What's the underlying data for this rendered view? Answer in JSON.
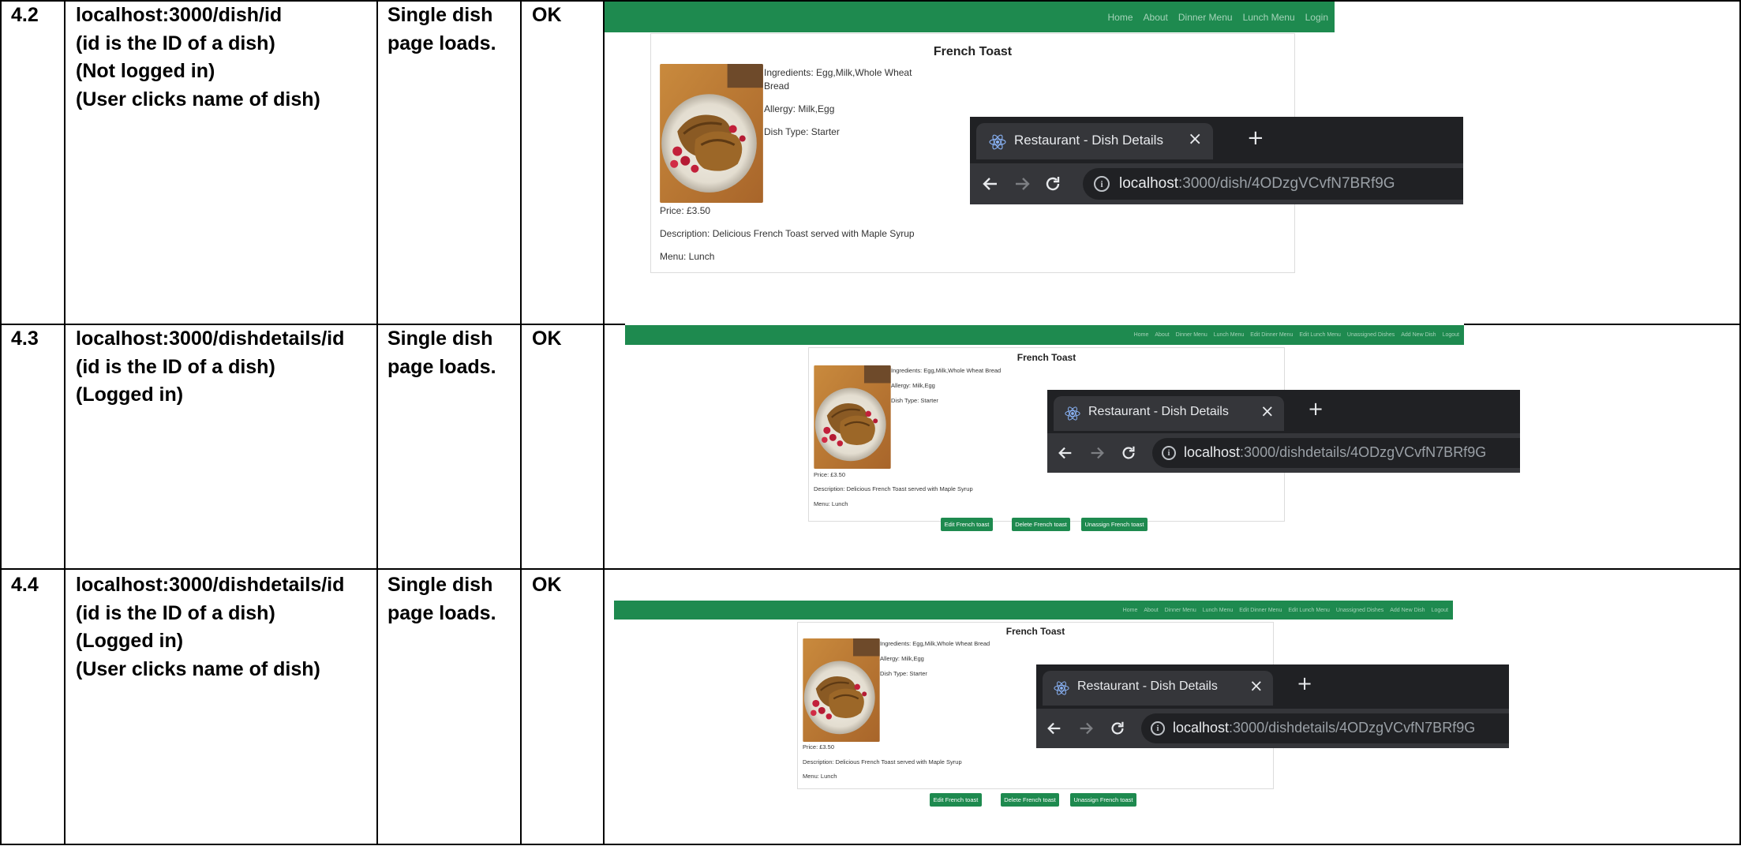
{
  "rows": [
    {
      "id": "4.2",
      "description_lines": [
        "localhost:3000/dish/id",
        "(id is the ID of a dish)",
        "(Not logged in)",
        "(User clicks name of dish)"
      ],
      "expected_lines": [
        "Single dish",
        "page loads."
      ],
      "result": "OK"
    },
    {
      "id": "4.3",
      "description_lines": [
        "localhost:3000/dishdetails/id",
        "(id is the ID of a dish)",
        "(Logged in)"
      ],
      "expected_lines": [
        "Single dish",
        "page loads."
      ],
      "result": "OK"
    },
    {
      "id": "4.4",
      "description_lines": [
        "localhost:3000/dishdetails/id",
        "(id is the ID of a dish)",
        "(Logged in)",
        "(User clicks name of dish)"
      ],
      "expected_lines": [
        "Single dish",
        "page loads."
      ],
      "result": "OK"
    }
  ],
  "screens": [
    {
      "nav": [
        "Home",
        "About",
        "Dinner Menu",
        "Lunch Menu",
        "Login"
      ],
      "dish": {
        "title": "French Toast",
        "ingredients": "Ingredients: Egg,Milk,Whole Wheat",
        "ingredients_cont": "Bread",
        "allergy": "Allergy: Milk,Egg",
        "type": "Dish Type: Starter",
        "price": "Price: £3.50",
        "description": "Description: Delicious French Toast served with Maple Syrup",
        "menu": "Menu: Lunch"
      },
      "browser": {
        "tab_title": "Restaurant - Dish Details",
        "url_host": "localhost",
        "url_path": ":3000/dish/4ODzgVCvfN7BRf9G"
      }
    },
    {
      "nav": [
        "Home",
        "About",
        "Dinner Menu",
        "Lunch Menu",
        "Edit Dinner Menu",
        "Edit Lunch Menu",
        "Unassigned Dishes",
        "Add New Dish",
        "Logout"
      ],
      "dish": {
        "title": "French Toast",
        "ingredients": "Ingredients: Egg,Milk,Whole Wheat Bread",
        "allergy": "Allergy: Milk,Egg",
        "type": "Dish Type: Starter",
        "price": "Price: £3.50",
        "description": "Description: Delicious French Toast served with Maple Syrup",
        "menu": "Menu: Lunch"
      },
      "buttons": [
        "Edit French toast",
        "Delete French toast",
        "Unassign French toast"
      ],
      "browser": {
        "tab_title": "Restaurant - Dish Details",
        "url_host": "localhost",
        "url_path": ":3000/dishdetails/4ODzgVCvfN7BRf9G"
      }
    },
    {
      "nav": [
        "Home",
        "About",
        "Dinner Menu",
        "Lunch Menu",
        "Edit Dinner Menu",
        "Edit Lunch Menu",
        "Unassigned Dishes",
        "Add New Dish",
        "Logout"
      ],
      "dish": {
        "title": "French Toast",
        "ingredients": "Ingredients: Egg,Milk,Whole Wheat Bread",
        "allergy": "Allergy: Milk,Egg",
        "type": "Dish Type: Starter",
        "price": "Price: £3.50",
        "description": "Description: Delicious French Toast served with Maple Syrup",
        "menu": "Menu: Lunch"
      },
      "buttons": [
        "Edit French toast",
        "Delete French toast",
        "Unassign French toast"
      ],
      "browser": {
        "tab_title": "Restaurant - Dish Details",
        "url_host": "localhost",
        "url_path": ":3000/dishdetails/4ODzgVCvfN7BRf9G"
      }
    }
  ],
  "colors": {
    "navbar": "#1e8a4f",
    "button": "#1e8a4f",
    "browser_dark": "#202124",
    "browser_tab": "#35363a"
  },
  "icons": [
    "react-logo-icon",
    "close-icon",
    "new-tab-icon",
    "back-arrow-icon",
    "forward-arrow-icon",
    "reload-icon",
    "info-icon"
  ]
}
